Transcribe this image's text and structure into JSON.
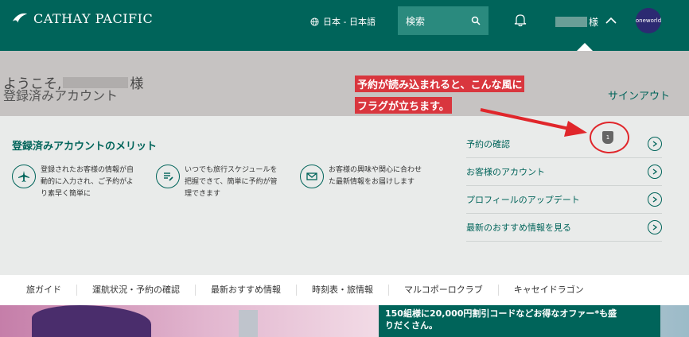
{
  "header": {
    "logo_text": "CATHAY PACIFIC",
    "language": "日本 - 日本語",
    "search_label": "検索",
    "user_suffix": "様",
    "oneworld_label": "oneworld",
    "brand_color": "#00645a"
  },
  "welcome": {
    "greeting_prefix": "ようこそ,",
    "greeting_suffix": "様",
    "account_type": "登録済みアカウント",
    "signout_label": "サインアウト"
  },
  "annotation": {
    "line1": "予約が読み込まれると、こんな風に",
    "line2": "フラグが立ちます。",
    "color": "#e0262b"
  },
  "benefits": {
    "title": "登録済みアカウントのメリット",
    "items": [
      {
        "icon": "airplane-icon",
        "text": "登録されたお客様の情報が自\n動的に入力され、ご予約がよ\nり素早く簡単に"
      },
      {
        "icon": "itinerary-list-icon",
        "text": "いつでも旅行スケジュールを\n把握できて、簡単に予約が管\n理できます"
      },
      {
        "icon": "envelope-icon",
        "text": "お客様の興味や関心に合わせ\nた最新情報をお届けします"
      }
    ]
  },
  "links": [
    {
      "label": "予約の確認",
      "badge": "1"
    },
    {
      "label": "お客様のアカウント"
    },
    {
      "label": "プロフィールのアップデート"
    },
    {
      "label": "最新のおすすめ情報を見る"
    }
  ],
  "nav": [
    "旅ガイド",
    "運航状況・予約の確認",
    "最新おすすめ情報",
    "時刻表・旅情報",
    "マルコポーロクラブ",
    "キャセイドラゴン"
  ],
  "promo": {
    "line1": "150組様に20,000円割引コードなどお得なオファー*も盛",
    "line2": "りだくさん。"
  }
}
